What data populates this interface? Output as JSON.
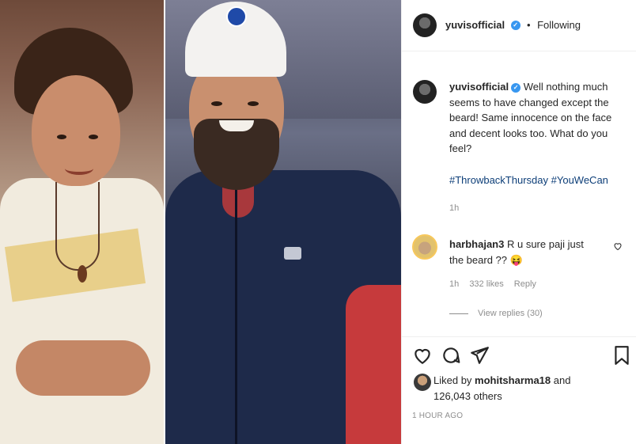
{
  "post": {
    "author": "yuvisofficial",
    "follow_status": "Following",
    "separator": "•",
    "caption_text": "Well nothing much seems to have changed except the beard! Same innocence on the face and decent looks too. What do you feel?",
    "hashtags": [
      "#ThrowbackThursday",
      "#YouWeCan"
    ],
    "caption_time": "1h",
    "comment": {
      "author": "harbhajan3",
      "text": "R u sure paji just the beard ?? 😝",
      "time": "1h",
      "likes": "332 likes",
      "reply_label": "Reply",
      "view_replies": "View replies (30)"
    },
    "likes": {
      "prefix": "Liked by",
      "user": "mohitsharma18",
      "suffix": "and",
      "count": "126,043 others"
    },
    "time_ago": "1 HOUR AGO"
  },
  "icons": {
    "verified": "verified-badge-icon",
    "like": "heart-icon",
    "comment": "comment-icon",
    "share": "share-icon",
    "save": "bookmark-icon"
  },
  "colors": {
    "verified": "#3897f0",
    "text": "#262626",
    "muted": "#8e8e8e",
    "hashtag": "#00376b"
  }
}
